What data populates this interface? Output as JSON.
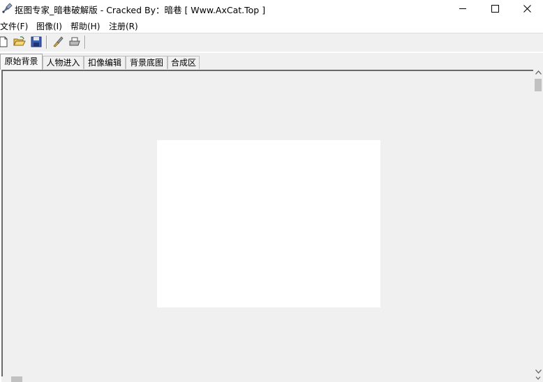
{
  "window": {
    "title": "抠图专家_暗巷破解版 - Cracked By：暗巷 [ Www.AxCat.Top ]"
  },
  "menu": {
    "items": [
      {
        "label": "文件(F)"
      },
      {
        "label": "图像(I)"
      },
      {
        "label": "帮助(H)"
      },
      {
        "label": "注册(R)"
      }
    ]
  },
  "toolbar": {
    "buttons": [
      "new-file-icon",
      "open-folder-icon",
      "save-disk-icon",
      "brush-icon",
      "print-icon"
    ]
  },
  "tabs": [
    {
      "label": "原始背景",
      "active": true
    },
    {
      "label": "人物进入",
      "active": false
    },
    {
      "label": "扣像编辑",
      "active": false
    },
    {
      "label": "背景底图",
      "active": false
    },
    {
      "label": "合成区",
      "active": false
    }
  ],
  "colors": {
    "workspace": "#f0f0f0",
    "canvas": "#ffffff"
  }
}
